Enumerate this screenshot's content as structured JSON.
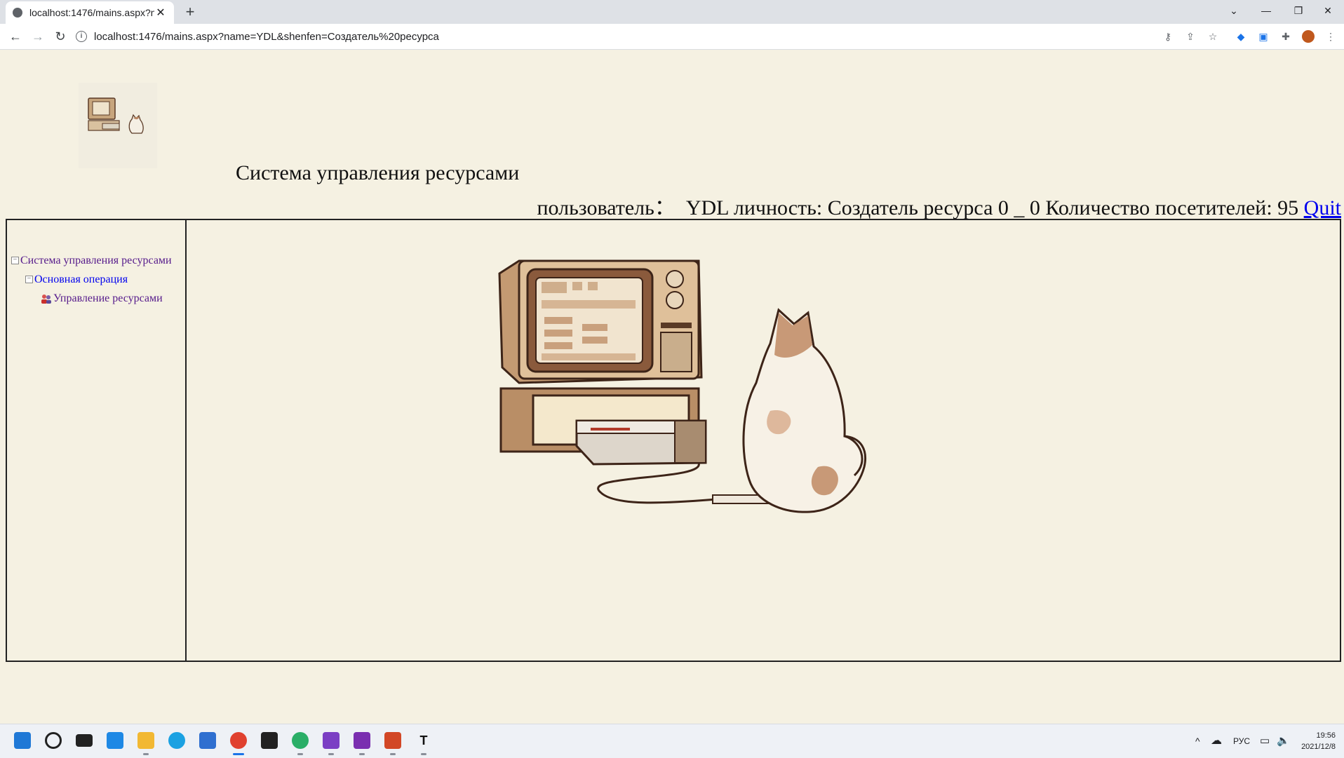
{
  "browser": {
    "tab_title": "localhost:1476/mains.aspx?na",
    "tab_close": "✕",
    "new_tab": "+",
    "url": "localhost:1476/mains.aspx?name=YDL&shenfen=Создатель%20ресурса",
    "back": "←",
    "forward": "→",
    "reload": "↻",
    "window_controls": {
      "tabsearch": "⌄",
      "minimize": "—",
      "restore": "❐",
      "close": "✕"
    }
  },
  "page": {
    "title": "Система управления ресурсами",
    "user_line": "пользователь：  YDL личность: Создатель ресурса 0 _ 0 Количество посетителей: 95 ",
    "quit_link": "Quit"
  },
  "tree": {
    "root": "Система управления ресурсами",
    "level2": "Основная операция",
    "level3": "Управление ресурсами",
    "expander": "−"
  },
  "taskbar": {
    "tray_lang": "РУС",
    "time": "19:56",
    "date": "2021/12/8",
    "chevron": "^"
  },
  "colors": {
    "page_bg": "#f5f1e2",
    "link": "#0000ee",
    "visited": "#551a8b"
  }
}
